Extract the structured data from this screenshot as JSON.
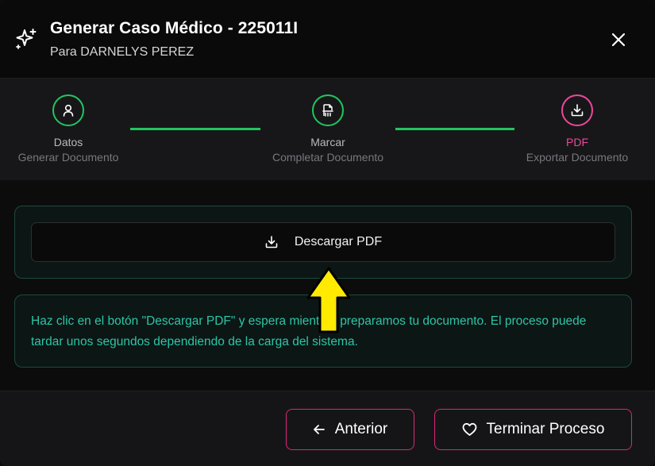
{
  "header": {
    "title": "Generar Caso Médico - 225011I",
    "subtitle": "Para DARNELYS PEREZ"
  },
  "steps": [
    {
      "label": "Datos",
      "description": "Generar Documento",
      "icon": "user-icon",
      "state": "complete"
    },
    {
      "label": "Marcar",
      "description": "Completar Documento",
      "icon": "file-signature-icon",
      "state": "complete"
    },
    {
      "label": "PDF",
      "description": "Exportar Documento",
      "icon": "download-icon",
      "state": "active"
    }
  ],
  "download": {
    "label": "Descargar PDF"
  },
  "info": {
    "text": "Haz clic en el botón \"Descargar PDF\" y espera mientras preparamos tu documento. El proceso puede tardar unos segundos dependiendo de la carga del sistema."
  },
  "footer": {
    "prev_label": "Anterior",
    "finish_label": "Terminar Proceso"
  },
  "colors": {
    "success": "#22c55e",
    "accent": "#ec4899",
    "info_text": "#2ec5a6",
    "arrow": "#ffea00"
  }
}
